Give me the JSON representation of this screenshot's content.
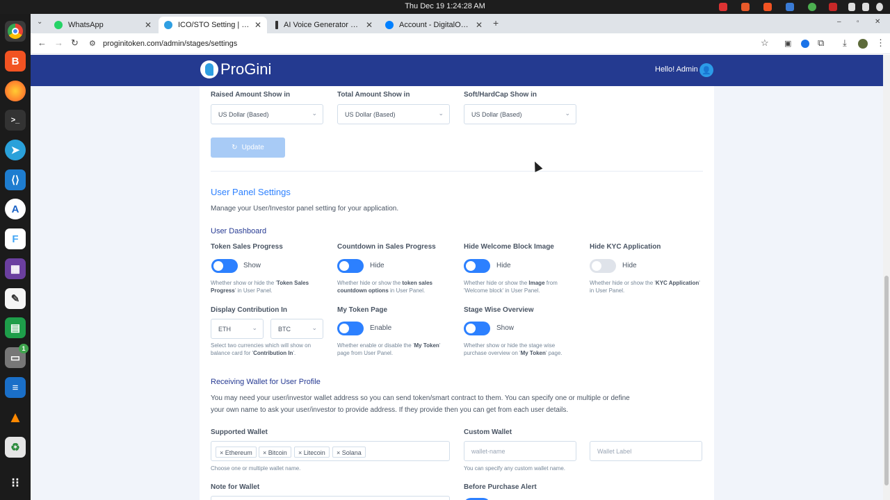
{
  "topbar": {
    "datetime": "Thu Dec 19  1:24:28 AM"
  },
  "tabs": [
    {
      "title": "WhatsApp",
      "icon": "whatsapp-icon",
      "color": "#25d366"
    },
    {
      "title": "ICO/STO Setting | ProGini",
      "icon": "progini-icon",
      "color": "#2f9fe2"
    },
    {
      "title": "AI Voice Generator & Text",
      "icon": "elevenlabs-icon",
      "color": "#333333"
    },
    {
      "title": "Account - DigitalOcean",
      "icon": "digitalocean-icon",
      "color": "#0080ff"
    }
  ],
  "browser": {
    "url": "proginitoken.com/admin/stages/settings"
  },
  "header": {
    "logo_text": "ProGini",
    "greeting": "Hello! Admin"
  },
  "show_in": {
    "fields": [
      {
        "label": "Raised Amount Show in",
        "value": "US Dollar (Based)"
      },
      {
        "label": "Total Amount Show in",
        "value": "US Dollar (Based)"
      },
      {
        "label": "Soft/HardCap Show in",
        "value": "US Dollar (Based)"
      }
    ],
    "update_label": "Update"
  },
  "user_panel": {
    "title": "User Panel Settings",
    "description": "Manage your User/Investor panel setting for your application.",
    "dashboard_title": "User Dashboard",
    "toggles": [
      {
        "label": "Token Sales Progress",
        "state": "Show",
        "hint_pre": "Whether show or hide the '",
        "hint_bold": "Token Sales Progress",
        "hint_post": "' in User Panel."
      },
      {
        "label": "Countdown in Sales Progress",
        "state": "Hide",
        "hint_pre": "Whether hide or show the ",
        "hint_bold": "token sales countdown options",
        "hint_post": " in User Panel."
      },
      {
        "label": "Hide Welcome Block Image",
        "state": "Hide",
        "hint_pre": "Whether hide or show the ",
        "hint_bold": "Image",
        "hint_post": " from 'Welcome block' in User Panel."
      },
      {
        "label": "Hide KYC Application",
        "state": "Hide",
        "hint_pre": "Whether hide or show the '",
        "hint_bold": "KYC Application",
        "hint_post": "' in User Panel."
      }
    ],
    "contribution": {
      "label": "Display Contribution In",
      "currency1": "ETH",
      "currency2": "BTC",
      "hint_pre": "Select two currencies which will show on balance card for '",
      "hint_bold": "Contribution In",
      "hint_post": "'."
    },
    "token_page": {
      "label": "My Token Page",
      "state": "Enable",
      "hint_pre": "Whether enable or disable the '",
      "hint_bold": "My Token",
      "hint_post": "' page from User Panel."
    },
    "stage_overview": {
      "label": "Stage Wise Overview",
      "state": "Show",
      "hint_pre": "Whether show or hide the stage wise purchase overview on '",
      "hint_bold": "My Token",
      "hint_post": "' page."
    }
  },
  "wallet": {
    "title": "Receiving Wallet for User Profile",
    "desc1": "You may need your user/investor wallet address so you can send token/smart contract to them. You can specify one or multiple or define",
    "desc2": "your own name to ask your user/investor to provide address. If they provide then you can get from each user details.",
    "supported_label": "Supported Wallet",
    "chips": [
      "Ethereum",
      "Bitcoin",
      "Litecoin",
      "Solana"
    ],
    "supported_hint": "Choose one or multiple wallet name.",
    "custom_label": "Custom Wallet",
    "custom_placeholder": "wallet-name",
    "custom_label_placeholder": "Wallet Label",
    "custom_hint": "You can specify any custom wallet name.",
    "note_label": "Note for Wallet",
    "alert_label": "Before Purchase Alert"
  }
}
